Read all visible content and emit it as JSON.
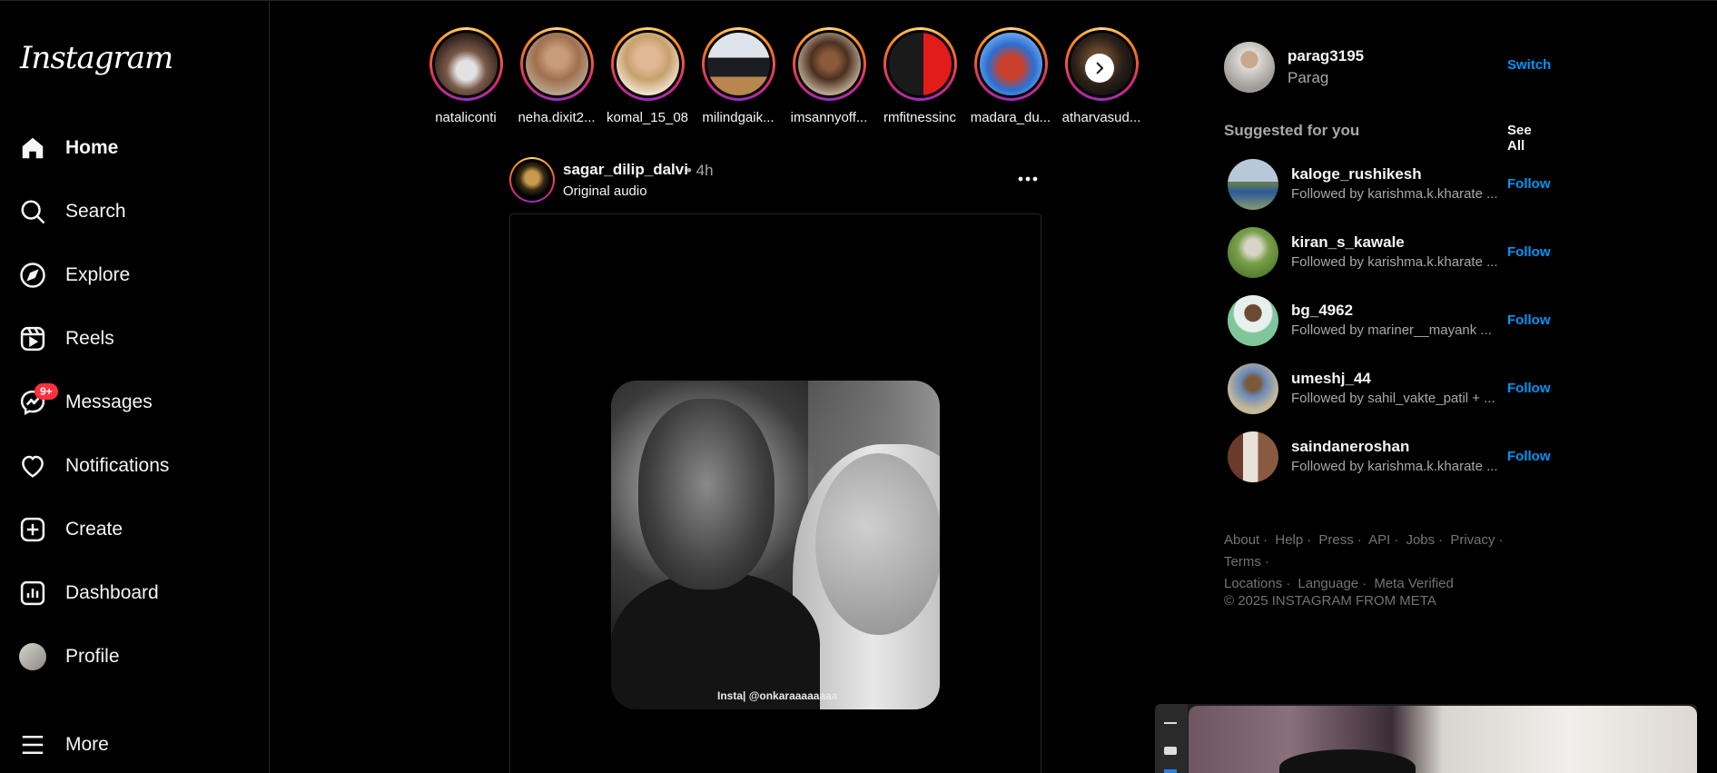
{
  "app": {
    "logo_text": "Instagram"
  },
  "sidebar": {
    "items": [
      {
        "label": "Home",
        "icon": "home-icon"
      },
      {
        "label": "Search",
        "icon": "search-icon"
      },
      {
        "label": "Explore",
        "icon": "explore-compass-icon"
      },
      {
        "label": "Reels",
        "icon": "reels-icon"
      },
      {
        "label": "Messages",
        "icon": "messenger-icon",
        "badge": "9+"
      },
      {
        "label": "Notifications",
        "icon": "heart-icon"
      },
      {
        "label": "Create",
        "icon": "plus-square-icon"
      },
      {
        "label": "Dashboard",
        "icon": "dashboard-icon"
      },
      {
        "label": "Profile",
        "icon": "profile-avatar"
      },
      {
        "label": "More",
        "icon": "hamburger-menu-icon"
      }
    ]
  },
  "stories": [
    {
      "username": "nataliconti"
    },
    {
      "username": "neha.dixit2..."
    },
    {
      "username": "komal_15_08"
    },
    {
      "username": "milindgaik..."
    },
    {
      "username": "imsannyoff..."
    },
    {
      "username": "rmfitnessinc"
    },
    {
      "username": "madara_du..."
    },
    {
      "username": "atharvasud..."
    }
  ],
  "post": {
    "username": "sagar_dilip_dalvi",
    "time": "• 4h",
    "audio": "Original audio",
    "watermark": "Insta| @onkaraaaaaaaa"
  },
  "account": {
    "username": "parag3195",
    "name": "Parag",
    "switch_label": "Switch"
  },
  "suggestions": {
    "title": "Suggested for you",
    "see_all": "See All",
    "items": [
      {
        "username": "kaloge_rushikesh",
        "subtitle": "Followed by karishma.k.kharate ...",
        "action": "Follow"
      },
      {
        "username": "kiran_s_kawale",
        "subtitle": "Followed by karishma.k.kharate ...",
        "action": "Follow"
      },
      {
        "username": "bg_4962",
        "subtitle": "Followed by mariner__mayank ...",
        "action": "Follow"
      },
      {
        "username": "umeshj_44",
        "subtitle": "Followed by sahil_vakte_patil + ...",
        "action": "Follow"
      },
      {
        "username": "saindaneroshan",
        "subtitle": "Followed by karishma.k.kharate ...",
        "action": "Follow"
      }
    ]
  },
  "footer": {
    "links": [
      "About",
      "Help",
      "Press",
      "API",
      "Jobs",
      "Privacy",
      "Terms",
      "Locations",
      "Language",
      "Meta Verified"
    ],
    "copyright": "© 2025 INSTAGRAM FROM META"
  },
  "colors": {
    "link_blue": "#0095f6",
    "badge_red": "#ff3040",
    "background": "#000000"
  }
}
